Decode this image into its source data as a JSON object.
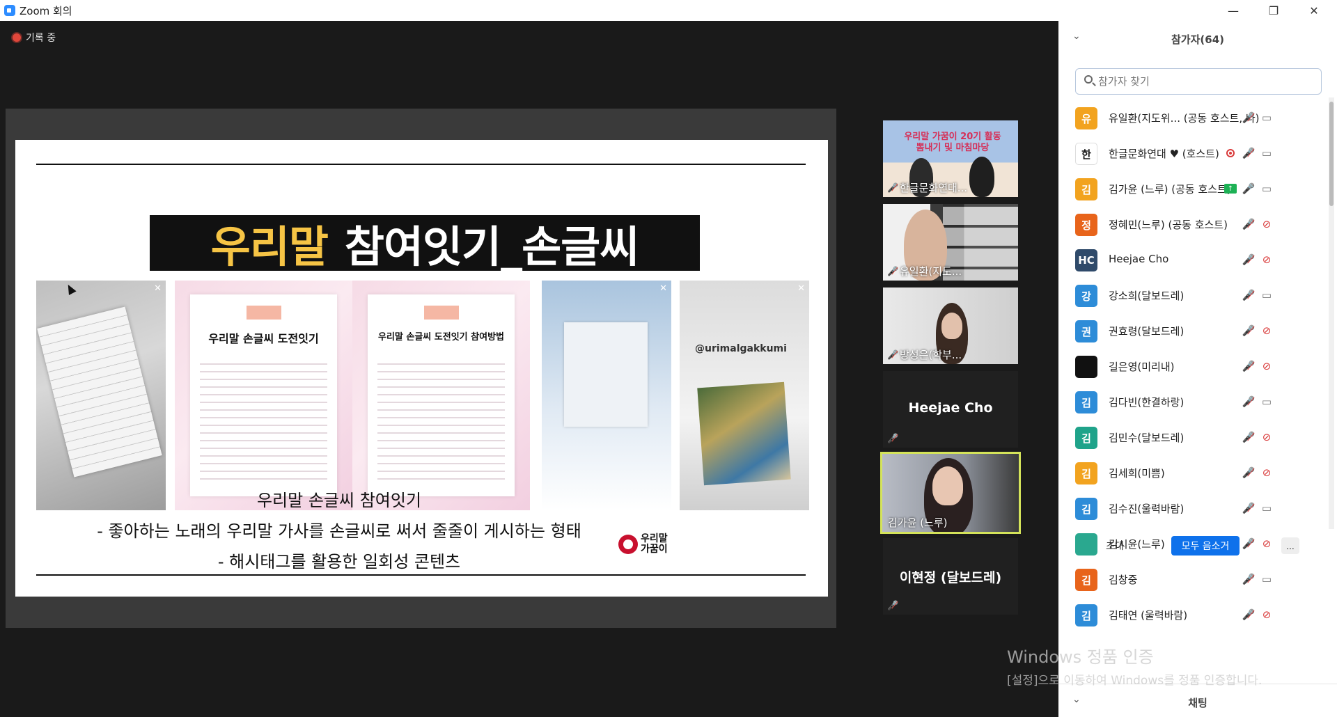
{
  "window": {
    "title": "Zoom 회의",
    "minimize": "—",
    "restore": "❐",
    "close": "✕"
  },
  "meeting": {
    "recording_label": "기록 중"
  },
  "slide": {
    "title_highlight": "우리말",
    "title_rest": "참여잇기_손글씨",
    "thumbs": [
      {
        "type": "notebook"
      },
      {
        "type": "pink",
        "head": "우리말 손글씨 도전잇기"
      },
      {
        "type": "pink",
        "head": "우리말 손글씨 도전잇기 참여방법"
      },
      {
        "type": "sky"
      },
      {
        "type": "photo",
        "handle": "@urimalgakkumi"
      }
    ],
    "caption_lines": [
      "우리말 손글씨 참여잇기",
      "- 좋아하는 노래의 우리말 가사를 손글씨로 써서 줄줄이 게시하는 형태",
      "- 해시태그를 활용한 일회성 콘텐츠"
    ],
    "logo_text": "우리말 가꿈이"
  },
  "videos": [
    {
      "name": "한글문화연대...",
      "style": "banner",
      "banner_text": "우리말 가꿈이 20기 활동뽐내기 및 마침마당",
      "muted": true
    },
    {
      "name": "유일환(지도...",
      "style": "office",
      "muted": true
    },
    {
      "name": "방성은(학부...",
      "style": "light",
      "muted": true
    },
    {
      "name": "Heejae Cho",
      "style": "noavatar",
      "muted": true
    },
    {
      "name": "김가윤 (느루)",
      "style": "home",
      "muted": false,
      "active": true
    },
    {
      "name": "이현정 (달보드레)",
      "style": "noavatar",
      "muted": true
    }
  ],
  "panel": {
    "title": "참가자(64)",
    "search_placeholder": "참가자 찾기",
    "participants": [
      {
        "initial": "유",
        "color": "#f2a31f",
        "name": "유일환(지도위... (공동 호스트, 나)",
        "mic": "muted",
        "cam": "on"
      },
      {
        "initial": "한",
        "color": "#ffffff",
        "name": "한글문화연대 ♥ (호스트)",
        "mic": "muted",
        "cam": "on",
        "recording": true
      },
      {
        "initial": "김",
        "color": "#f2a31f",
        "name": "김가윤 (느루) (공동 호스트)",
        "mic": "on",
        "cam": "on",
        "sharing": true
      },
      {
        "initial": "정",
        "color": "#e8641b",
        "name": "정혜민(느루) (공동 호스트)",
        "mic": "muted",
        "cam": "off"
      },
      {
        "initial": "HC",
        "color": "#2f4a6a",
        "name": "Heejae Cho",
        "mic": "muted",
        "cam": "off"
      },
      {
        "initial": "강",
        "color": "#2d8cd8",
        "name": "강소희(달보드레)",
        "mic": "muted",
        "cam": "on"
      },
      {
        "initial": "권",
        "color": "#2d8cd8",
        "name": "권효령(달보드레)",
        "mic": "muted",
        "cam": "off"
      },
      {
        "initial": "",
        "color": "#111111",
        "name": "길은영(미리내)",
        "mic": "muted",
        "cam": "off"
      },
      {
        "initial": "김",
        "color": "#2d8cd8",
        "name": "김다빈(한결하랑)",
        "mic": "muted",
        "cam": "on"
      },
      {
        "initial": "김",
        "color": "#1fa38a",
        "name": "김민수(달보드레)",
        "mic": "muted",
        "cam": "off"
      },
      {
        "initial": "김",
        "color": "#f2a31f",
        "name": "김세희(미쁨)",
        "mic": "muted",
        "cam": "off"
      },
      {
        "initial": "김",
        "color": "#2d8cd8",
        "name": "김수진(울력바람)",
        "mic": "muted",
        "cam": "on"
      },
      {
        "initial": "",
        "color": "#2aa88f",
        "name": "김시윤(느루)",
        "mic": "muted",
        "cam": "off"
      },
      {
        "initial": "김",
        "color": "#e8641b",
        "name": "김창중",
        "mic": "muted",
        "cam": "on"
      },
      {
        "initial": "김",
        "color": "#2d8cd8",
        "name": "김태연 (울력바람)",
        "mic": "muted",
        "cam": "off"
      }
    ],
    "invite_label": "초대",
    "mute_all_label": "모두 음소거",
    "more_label": "...",
    "chat_title": "채팅"
  },
  "watermark": {
    "line1": "Windows 정품 인증",
    "line2": "[설정]으로 이동하여 Windows를 정품 인증합니다."
  }
}
